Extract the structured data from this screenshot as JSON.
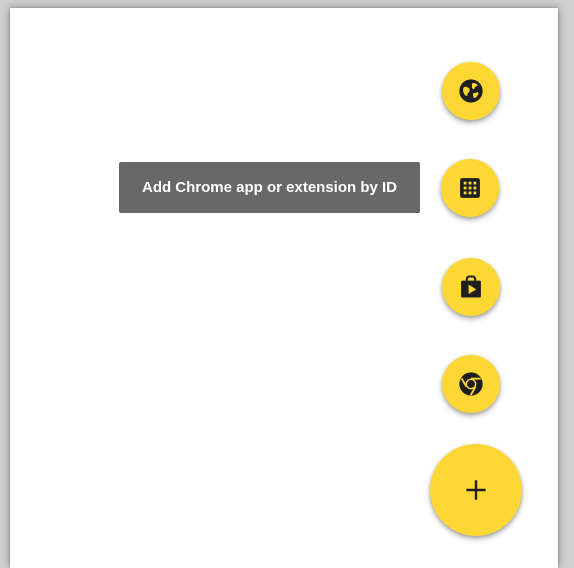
{
  "tooltip": {
    "text": "Add Chrome app or extension by ID"
  },
  "speed_dial": {
    "actions": [
      {
        "name": "globe",
        "icon": "globe-icon"
      },
      {
        "name": "add-by-id",
        "icon": "grid-apps-icon"
      },
      {
        "name": "play-store",
        "icon": "play-store-icon"
      },
      {
        "name": "chrome",
        "icon": "chrome-icon"
      }
    ],
    "main_button_icon": "plus-icon"
  },
  "colors": {
    "fab": "#fdd835",
    "icon": "#1f1f1f",
    "tooltip_bg": "#686868",
    "tooltip_text": "#ffffff",
    "background": "#ffffff"
  }
}
